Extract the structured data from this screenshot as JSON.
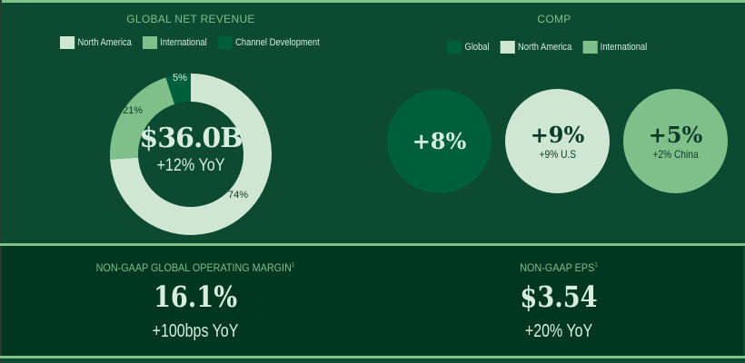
{
  "chart_data": [
    {
      "type": "pie",
      "title": "GLOBAL NET REVENUE",
      "categories": [
        "North America",
        "International",
        "Channel Development"
      ],
      "values": [
        74,
        21,
        5
      ],
      "labels": [
        "74%",
        "21%",
        "5%"
      ],
      "colors": [
        "#cfe6d3",
        "#7fc08a",
        "#005f3c"
      ],
      "center_value": "$36.0B",
      "center_sub": "+12% YoY",
      "legend_position": "top"
    },
    {
      "type": "bar",
      "title": "COMP",
      "categories": [
        "Global",
        "North America",
        "International"
      ],
      "values": [
        8,
        9,
        5
      ],
      "labels": [
        "+8%",
        "+9%",
        "+5%"
      ],
      "sublabels": [
        "",
        "+9% U.S",
        "+2% China"
      ],
      "colors": [
        "#005f3c",
        "#cfe6d3",
        "#7fc08a"
      ],
      "legend_position": "top"
    }
  ],
  "kpis": [
    {
      "title": "NON-GAAP GLOBAL OPERATING MARGIN",
      "sup": "1",
      "value": "16.1%",
      "sub": "+100bps YoY"
    },
    {
      "title": "NON-GAAP EPS",
      "sup": "1",
      "value": "$3.54",
      "sub": "+20% YoY"
    }
  ]
}
